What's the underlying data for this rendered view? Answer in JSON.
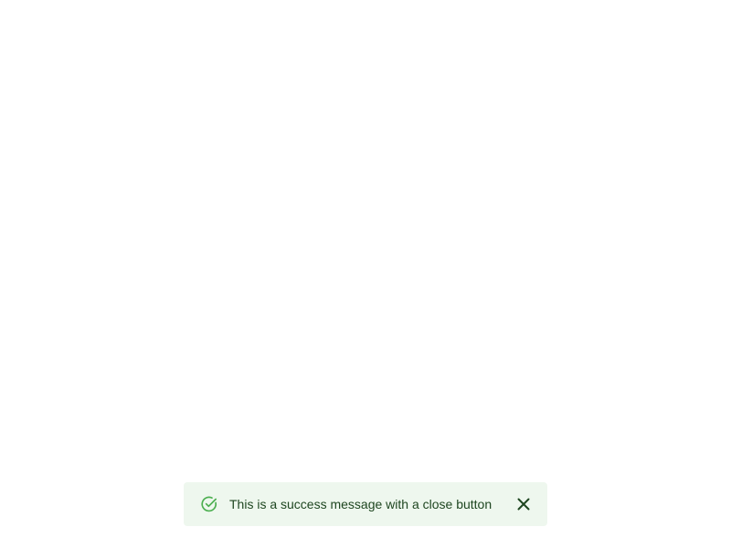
{
  "toast": {
    "variant": "success",
    "message": "This is a success message with a close button",
    "status_icon": "check-circle-icon",
    "close_icon": "close-icon",
    "colors": {
      "background": "#eef7ee",
      "text": "#1e4620",
      "icon": "#4caf50",
      "close": "#1e4620"
    }
  }
}
